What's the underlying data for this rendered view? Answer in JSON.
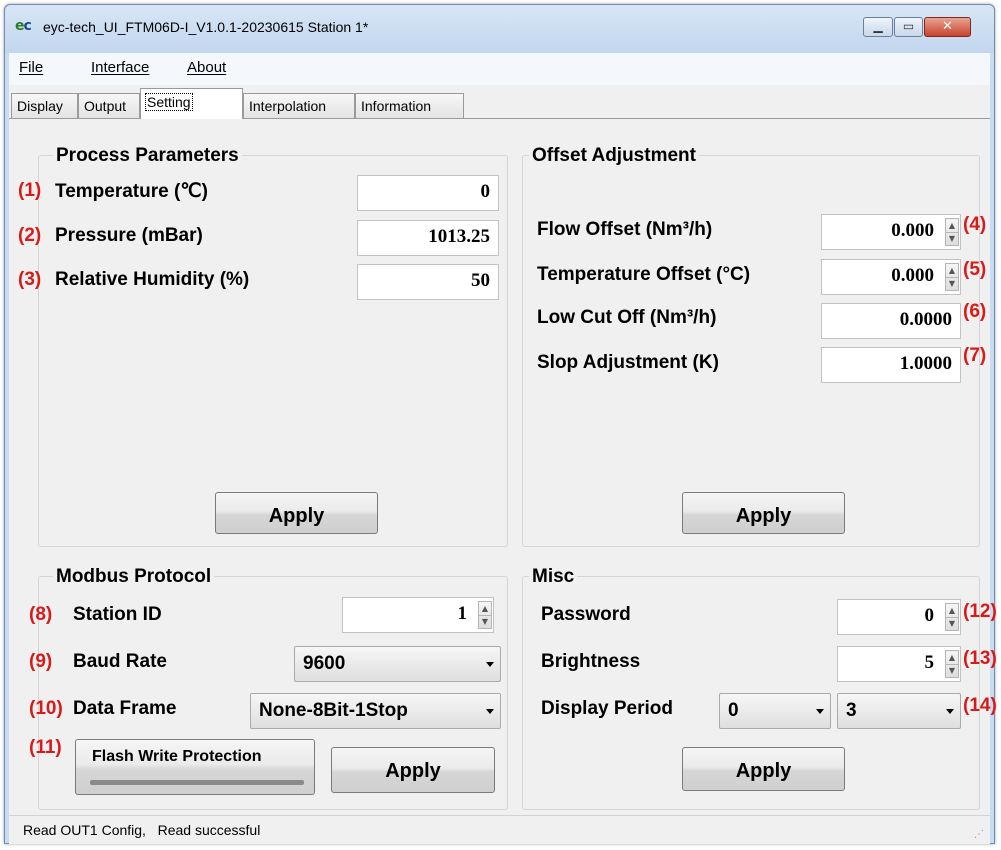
{
  "window": {
    "title": "eyc-tech_UI_FTM06D-I_V1.0.1-20230615  Station 1*",
    "min_glyph": "▁",
    "max_glyph": "▭",
    "close_glyph": "✕"
  },
  "menu": [
    "File",
    "Interface",
    "About"
  ],
  "tabs": [
    "Display",
    "Output",
    "Setting",
    "Interpolation",
    "Information"
  ],
  "active_tab": "Setting",
  "process": {
    "title": "Process Parameters",
    "rows": [
      {
        "num": "(1)",
        "label": "Temperature (℃)",
        "value": "0"
      },
      {
        "num": "(2)",
        "label": "Pressure (mBar)",
        "value": "1013.25"
      },
      {
        "num": "(3)",
        "label": "Relative Humidity (%)",
        "value": "50"
      }
    ],
    "apply": "Apply"
  },
  "offset": {
    "title": "Offset Adjustment",
    "rows": [
      {
        "num": "(4)",
        "label": "Flow Offset (Nm³/h)",
        "value": "0.000"
      },
      {
        "num": "(5)",
        "label": "Temperature Offset (°C)",
        "value": "0.000"
      },
      {
        "num": "(6)",
        "label": "Low Cut Off (Nm³/h)",
        "value": "0.0000"
      },
      {
        "num": "(7)",
        "label": "Slop Adjustment (K)",
        "value": "1.0000"
      }
    ],
    "apply": "Apply"
  },
  "modbus": {
    "title": "Modbus Protocol",
    "station": {
      "num": "(8)",
      "label": "Station ID",
      "value": "1"
    },
    "baud": {
      "num": "(9)",
      "label": "Baud Rate",
      "value": "9600"
    },
    "frame": {
      "num": "(10)",
      "label": "Data Frame",
      "value": "None-8Bit-1Stop"
    },
    "flash": {
      "num": "(11)",
      "label": "Flash Write Protection"
    },
    "apply": "Apply"
  },
  "misc": {
    "title": "Misc",
    "password": {
      "num": "(12)",
      "label": "Password",
      "value": "0"
    },
    "brightness": {
      "num": "(13)",
      "label": "Brightness",
      "value": "5"
    },
    "display_period": {
      "num": "(14)",
      "label": "Display Period",
      "value1": "0",
      "value2": "3"
    },
    "apply": "Apply"
  },
  "status": {
    "text": "Read OUT1 Config,   Read successful",
    "grip": "⋰"
  }
}
